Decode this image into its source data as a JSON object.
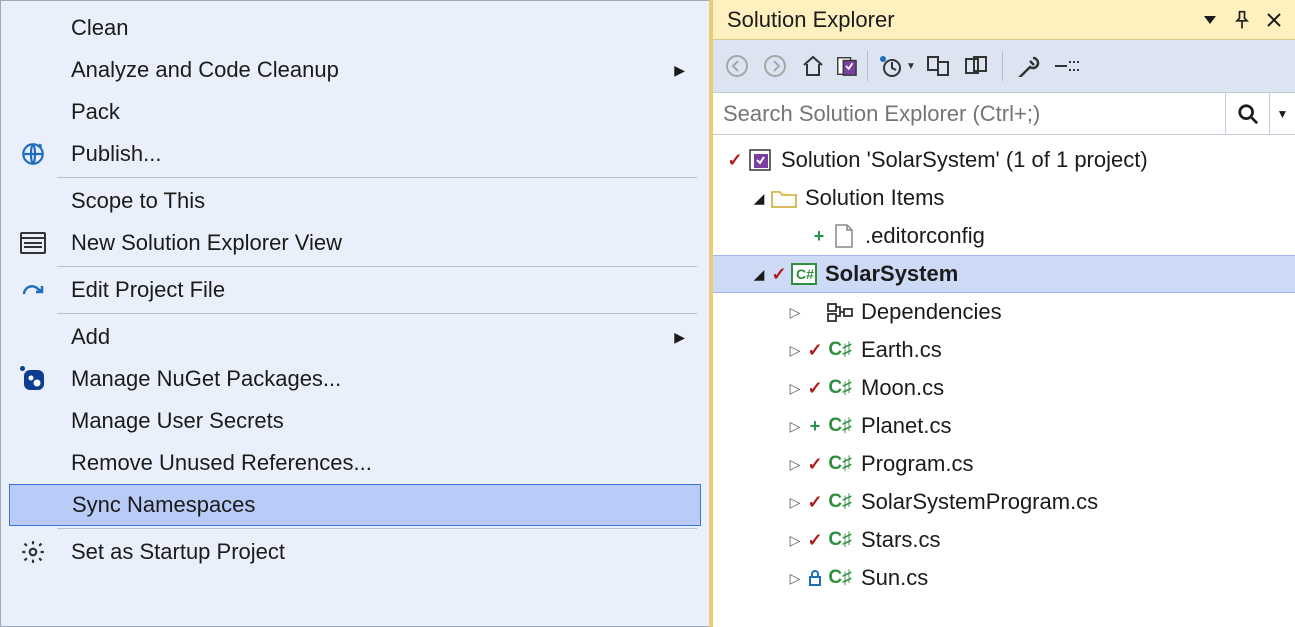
{
  "menu": {
    "clean": "Clean",
    "analyze": "Analyze and Code Cleanup",
    "pack": "Pack",
    "publish": "Publish...",
    "scope": "Scope to This",
    "newView": "New Solution Explorer View",
    "editProject": "Edit Project File",
    "add": "Add",
    "nuget": "Manage NuGet Packages...",
    "userSecrets": "Manage User Secrets",
    "removeUnused": "Remove Unused References...",
    "syncNs": "Sync Namespaces",
    "setStartup": "Set as Startup Project"
  },
  "explorer": {
    "title": "Solution Explorer",
    "search_placeholder": "Search Solution Explorer (Ctrl+;)",
    "solution": "Solution 'SolarSystem' (1 of 1 project)",
    "solutionItems": "Solution Items",
    "editorconfig": ".editorconfig",
    "project": "SolarSystem",
    "dependencies": "Dependencies",
    "files": {
      "earth": "Earth.cs",
      "moon": "Moon.cs",
      "planet": "Planet.cs",
      "program": "Program.cs",
      "ssprogram": "SolarSystemProgram.cs",
      "stars": "Stars.cs",
      "sun": "Sun.cs"
    }
  }
}
